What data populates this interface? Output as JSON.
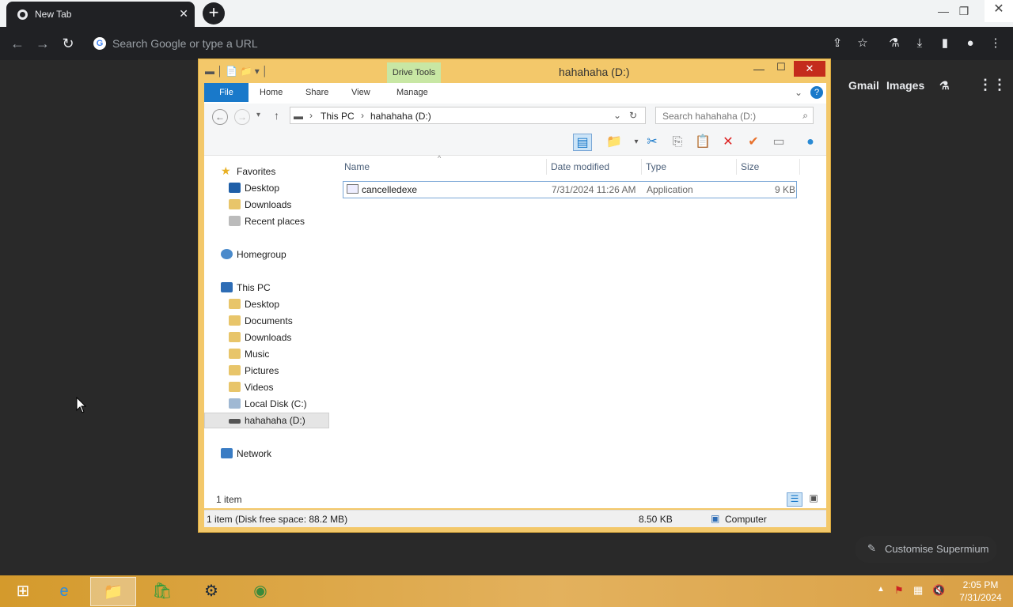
{
  "browser": {
    "tab_title": "New Tab",
    "omnibox_placeholder": "Search Google or type a URL",
    "links": [
      "Gmail",
      "Images"
    ],
    "customise_label": "Customise Supermium"
  },
  "explorer": {
    "title": "hahahaha (D:)",
    "drive_tools_label": "Drive Tools",
    "ribbon_tabs": {
      "file": "File",
      "home": "Home",
      "share": "Share",
      "view": "View",
      "manage": "Manage"
    },
    "address": {
      "this_pc": "This PC",
      "drive": "hahahaha (D:)"
    },
    "search_placeholder": "Search hahahaha (D:)",
    "nav": {
      "favorites": "Favorites",
      "fav_desktop": "Desktop",
      "fav_downloads": "Downloads",
      "fav_recent": "Recent places",
      "homegroup": "Homegroup",
      "this_pc": "This PC",
      "pc_desktop": "Desktop",
      "pc_documents": "Documents",
      "pc_downloads": "Downloads",
      "pc_music": "Music",
      "pc_pictures": "Pictures",
      "pc_videos": "Videos",
      "pc_local_disk": "Local Disk (C:)",
      "pc_drive_d": "hahahaha (D:)",
      "network": "Network"
    },
    "columns": {
      "name": "Name",
      "date": "Date modified",
      "type": "Type",
      "size": "Size"
    },
    "file": {
      "name": "cancelledexe",
      "date": "7/31/2024 11:26 AM",
      "type": "Application",
      "size": "9 KB"
    },
    "item_count": "1 item",
    "status_left": "1 item (Disk free space: 88.2 MB)",
    "status_size": "8.50 KB",
    "status_location": "Computer"
  },
  "taskbar": {
    "time": "2:05 PM",
    "date": "7/31/2024"
  }
}
